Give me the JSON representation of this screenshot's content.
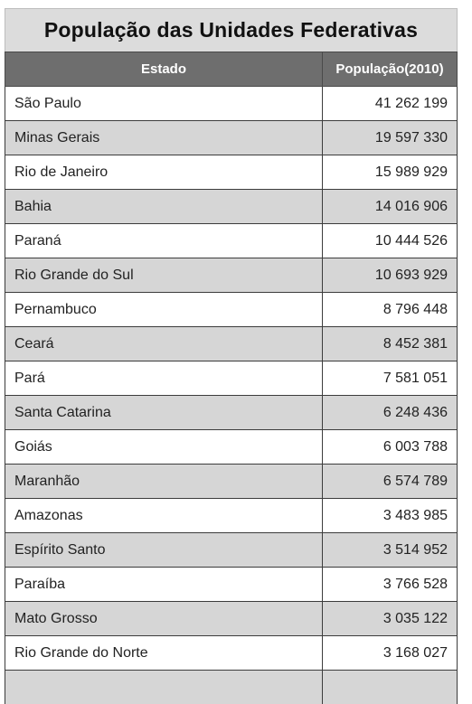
{
  "title": "População das Unidades Federativas",
  "table": {
    "headers": [
      "Estado",
      "População(2010)"
    ],
    "rows": [
      [
        "São Paulo",
        "41 262 199"
      ],
      [
        "Minas Gerais",
        "19 597 330"
      ],
      [
        "Rio de Janeiro",
        "15 989 929"
      ],
      [
        "Bahia",
        "14 016 906"
      ],
      [
        "Paraná",
        "10 444 526"
      ],
      [
        "Rio Grande do Sul",
        "10 693 929"
      ],
      [
        "Pernambuco",
        "8 796 448"
      ],
      [
        "Ceará",
        "8 452 381"
      ],
      [
        "Pará",
        "7 581 051"
      ],
      [
        "Santa Catarina",
        "6 248 436"
      ],
      [
        "Goiás",
        "6 003 788"
      ],
      [
        "Maranhão",
        "6 574 789"
      ],
      [
        "Amazonas",
        "3 483 985"
      ],
      [
        "Espírito Santo",
        "3 514 952"
      ],
      [
        "Paraíba",
        "3 766 528"
      ],
      [
        "Mato Grosso",
        "3 035 122"
      ],
      [
        "Rio Grande do Norte",
        "3 168 027"
      ],
      [
        "",
        ""
      ]
    ]
  }
}
